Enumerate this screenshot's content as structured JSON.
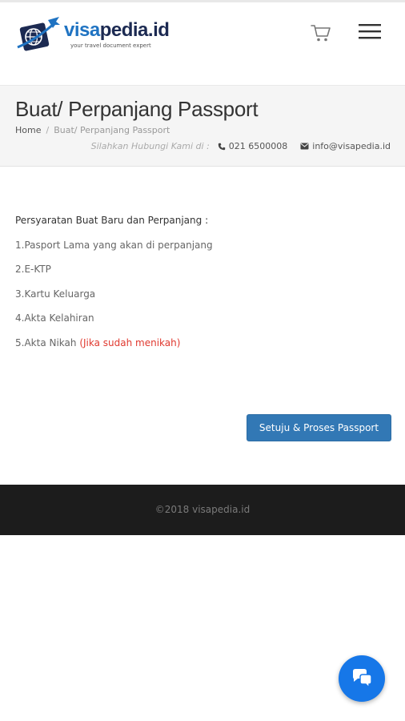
{
  "header": {
    "logo": {
      "brand_part1": "visa",
      "brand_part2": "pedia.id",
      "tagline": "your travel document expert"
    },
    "icons": {
      "cart": "cart-icon",
      "menu": "hamburger-menu-icon"
    }
  },
  "page": {
    "title": "Buat/ Perpanjang Passport",
    "breadcrumb": {
      "home": "Home",
      "separator": "/",
      "current": "Buat/ Perpanjang Passport"
    },
    "contact": {
      "hint": "Silahkan Hubungi Kami di :",
      "phone": "021 6500008",
      "email": "info@visapedia.id"
    }
  },
  "content": {
    "requirements_title": "Persyaratan Buat Baru dan Perpanjang :",
    "items": [
      {
        "text": "1.Pasport Lama yang akan di perpanjang",
        "note": ""
      },
      {
        "text": "2.E-KTP",
        "note": ""
      },
      {
        "text": "3.Kartu Keluarga",
        "note": ""
      },
      {
        "text": "4.Akta Kelahiran",
        "note": ""
      },
      {
        "text": "5.Akta Nikah ",
        "note": "(Jika sudah menikah)"
      }
    ],
    "button_label": "Setuju & Proses Passport"
  },
  "footer": {
    "copyright": "©2018 visapedia.id"
  },
  "colors": {
    "brand_blue": "#1f73c2",
    "brand_navy": "#1c2a52",
    "button": "#3278b5",
    "footer_bg": "#1c1c1c",
    "note_red": "#e0392f",
    "chat_button": "#1677e8"
  }
}
